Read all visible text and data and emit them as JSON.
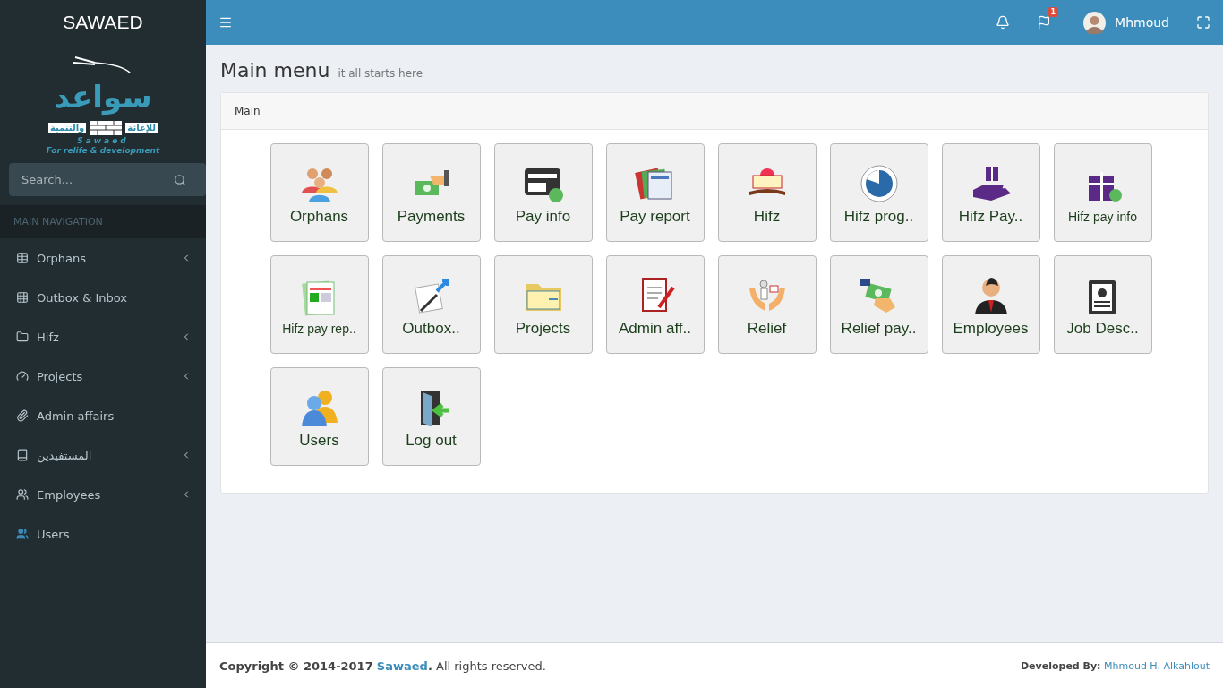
{
  "brand": {
    "title": "SAWAED",
    "logo_arabic": "سواعد",
    "logo_arabic_left": "والتنمية",
    "logo_arabic_right": "للإغاثة",
    "logo_latin": "Sawaed",
    "logo_tagline": "For relife & development"
  },
  "search": {
    "placeholder": "Search..."
  },
  "nav_header": "MAIN NAVIGATION",
  "sidebar": {
    "items": [
      {
        "label": "Orphans",
        "expandable": true,
        "selected": false
      },
      {
        "label": "Outbox & Inbox",
        "expandable": false,
        "selected": false
      },
      {
        "label": "Hifz",
        "expandable": true,
        "selected": false
      },
      {
        "label": "Projects",
        "expandable": true,
        "selected": false
      },
      {
        "label": "Admin affairs",
        "expandable": false,
        "selected": false
      },
      {
        "label": "المستفيدين",
        "expandable": true,
        "selected": false
      },
      {
        "label": "Employees",
        "expandable": true,
        "selected": false
      },
      {
        "label": "Users",
        "expandable": false,
        "selected": true
      }
    ]
  },
  "topbar": {
    "notification_badge": "1",
    "user_name": "Mhmoud"
  },
  "page": {
    "title": "Main menu",
    "subtitle": "it all starts here"
  },
  "panel": {
    "title": "Main",
    "tiles": [
      {
        "label": "Orphans",
        "kind": "normal"
      },
      {
        "label": "Payments",
        "kind": "normal"
      },
      {
        "label": "Pay info",
        "kind": "normal"
      },
      {
        "label": "Pay report",
        "kind": "normal"
      },
      {
        "label": "Hifz",
        "kind": "normal"
      },
      {
        "label": "Hifz prog..",
        "kind": "normal"
      },
      {
        "label": "Hifz Pay..",
        "kind": "normal"
      },
      {
        "label": "Hifz pay info",
        "kind": "compact"
      },
      {
        "label": "Hifz pay rep..",
        "kind": "compact"
      },
      {
        "label": "Outbox..",
        "kind": "normal"
      },
      {
        "label": "Projects",
        "kind": "normal"
      },
      {
        "label": "Admin aff..",
        "kind": "normal"
      },
      {
        "label": "Relief",
        "kind": "normal"
      },
      {
        "label": "Relief pay..",
        "kind": "normal"
      },
      {
        "label": "Employees",
        "kind": "normal"
      },
      {
        "label": "Job Desc..",
        "kind": "normal"
      },
      {
        "label": "Users",
        "kind": "normal"
      },
      {
        "label": "Log out",
        "kind": "normal"
      }
    ]
  },
  "footer": {
    "copyright_prefix": "**Copyright © 2014-2017** ",
    "copyright_link": "Sawaed",
    "copyright_suffix": "**.** All rights reserved.",
    "developer_label": "Developed By:",
    "developer_link": "Mhmoud H. Alkahlout"
  }
}
